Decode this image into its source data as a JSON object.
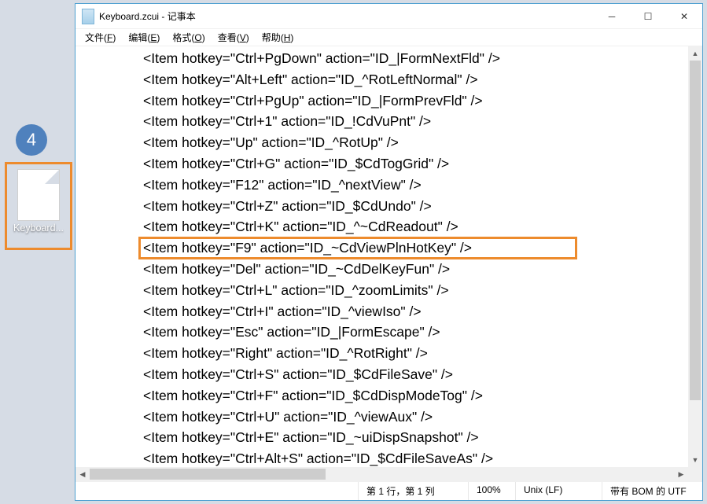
{
  "desktop": {
    "badge": "4",
    "file_label": "Keyboard..."
  },
  "window": {
    "title": "Keyboard.zcui - 记事本",
    "menu": [
      {
        "label": "文件",
        "ul": "F"
      },
      {
        "label": "编辑",
        "ul": "E"
      },
      {
        "label": "格式",
        "ul": "O"
      },
      {
        "label": "查看",
        "ul": "V"
      },
      {
        "label": "帮助",
        "ul": "H"
      }
    ]
  },
  "editor": {
    "lines": [
      "<Item hotkey=\"Ctrl+PgDown\" action=\"ID_|FormNextFld\" />",
      "<Item hotkey=\"Alt+Left\" action=\"ID_^RotLeftNormal\" />",
      "<Item hotkey=\"Ctrl+PgUp\" action=\"ID_|FormPrevFld\" />",
      "<Item hotkey=\"Ctrl+1\" action=\"ID_!CdVuPnt\" />",
      "<Item hotkey=\"Up\" action=\"ID_^RotUp\" />",
      "<Item hotkey=\"Ctrl+G\" action=\"ID_$CdTogGrid\" />",
      "<Item hotkey=\"F12\" action=\"ID_^nextView\" />",
      "<Item hotkey=\"Ctrl+Z\" action=\"ID_$CdUndo\" />",
      "<Item hotkey=\"Ctrl+K\" action=\"ID_^~CdReadout\" />",
      "<Item hotkey=\"F9\" action=\"ID_~CdViewPlnHotKey\" />",
      "<Item hotkey=\"Del\" action=\"ID_~CdDelKeyFun\" />",
      "<Item hotkey=\"Ctrl+L\" action=\"ID_^zoomLimits\" />",
      "<Item hotkey=\"Ctrl+I\" action=\"ID_^viewIso\" />",
      "<Item hotkey=\"Esc\" action=\"ID_|FormEscape\" />",
      "<Item hotkey=\"Right\" action=\"ID_^RotRight\" />",
      "<Item hotkey=\"Ctrl+S\" action=\"ID_$CdFileSave\" />",
      "<Item hotkey=\"Ctrl+F\" action=\"ID_$CdDispModeTog\" />",
      "<Item hotkey=\"Ctrl+U\" action=\"ID_^viewAux\" />",
      "<Item hotkey=\"Ctrl+E\" action=\"ID_~uiDispSnapshot\" />",
      "<Item hotkey=\"Ctrl+Alt+S\" action=\"ID_$CdFileSaveAs\" />"
    ],
    "highlight_index": 9
  },
  "status": {
    "pos": "第 1 行，第 1 列",
    "zoom": "100%",
    "eol": "Unix (LF)",
    "enc": "带有 BOM 的 UTF"
  }
}
